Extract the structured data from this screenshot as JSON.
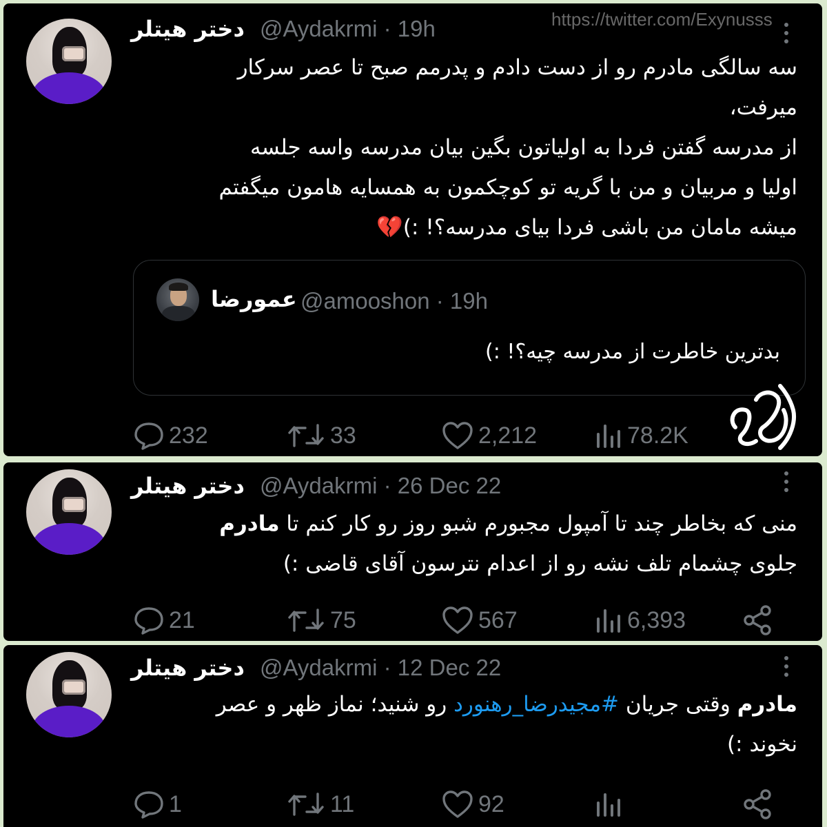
{
  "watermark": {
    "url": "https://twitter.com/Exynusss"
  },
  "tweets": [
    {
      "name": "دختر هیتلر",
      "handle": "@Aydakrmi · 19h",
      "lines": [
        "سه سالگی مادرم رو از دست دادم و پدرمم صبح تا عصر سرکار",
        "میرفت،",
        "از مدرسه گفتن فردا به اولیاتون بگین بیان مدرسه واسه جلسه",
        "اولیا و مربیان و من با گریه تو کوچکمون به همسایه هامون میگفتم",
        "میشه مامان من باشی فردا بیای مدرسه؟! :)💔"
      ],
      "quote": {
        "name": "عمورضا",
        "handle": "@amooshon · 19h",
        "text": "بدترین خاطرت از مدرسه چیه؟! :)"
      },
      "actions": {
        "replies": "232",
        "retweets": "33",
        "likes": "2,212",
        "views": "78.2K"
      }
    },
    {
      "name": "دختر هیتلر",
      "handle": "@Aydakrmi · 26 Dec 22",
      "line1_pre": "منی که بخاطر چند تا آمپول مجبورم شبو روز رو کار کنم تا ",
      "line1_bold": "مادرم",
      "line2": "جلوی چشمام تلف نشه رو از اعدام نترسون آقای قاضی :)",
      "actions": {
        "replies": "21",
        "retweets": "75",
        "likes": "567",
        "views": "6,393"
      }
    },
    {
      "name": "دختر هیتلر",
      "handle": "@Aydakrmi · 12 Dec 22",
      "line1_bold": "مادرم",
      "line1_mid": " وقتی جریان ",
      "line1_hashtag": "#مجیدرضا_رهنورد",
      "line1_post": " رو شنید؛ نماز ظهر و عصر",
      "line2": "نخوند :)",
      "actions": {
        "replies": "1",
        "retweets": "11",
        "likes": "92"
      }
    }
  ],
  "icons": [
    "reply-icon",
    "retweet-icon",
    "like-icon",
    "views-icon",
    "share-icon",
    "more-icon"
  ],
  "colors": {
    "background": "#000000",
    "text": "#ffffff",
    "muted": "#71767b",
    "link": "#1d9bf0",
    "frame": "#dbeacf"
  }
}
